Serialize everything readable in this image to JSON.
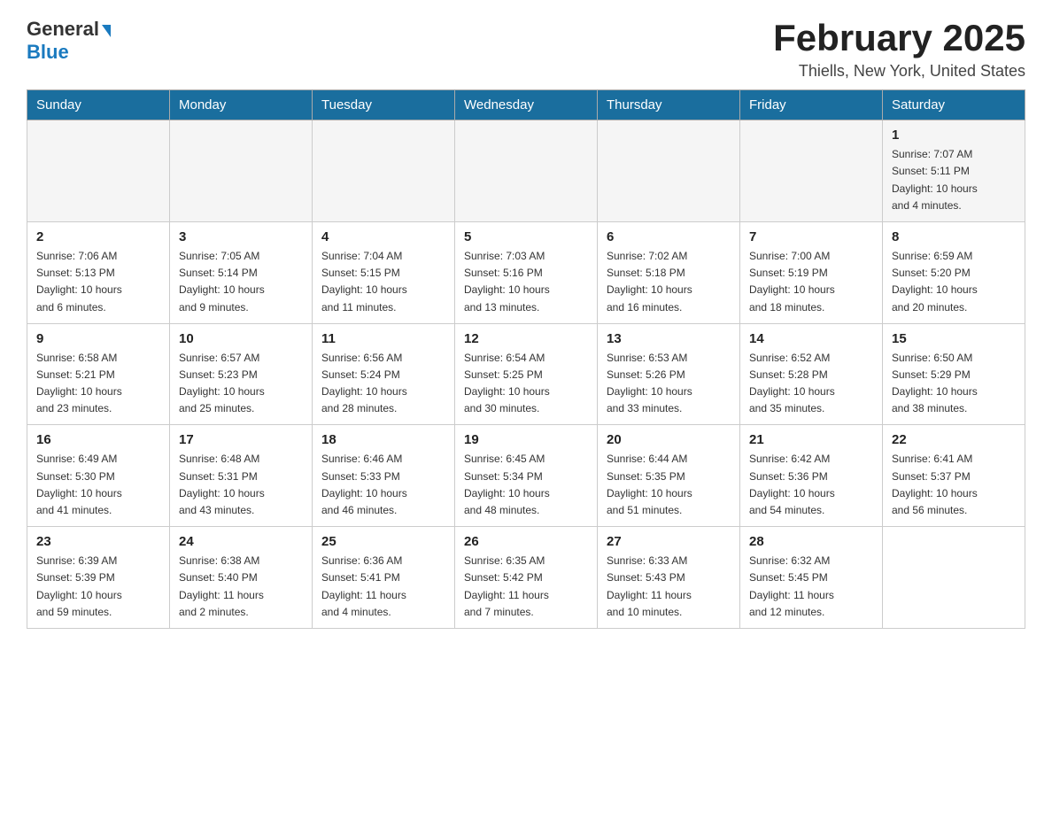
{
  "header": {
    "logo_general": "General",
    "logo_blue": "Blue",
    "title": "February 2025",
    "location": "Thiells, New York, United States"
  },
  "weekdays": [
    "Sunday",
    "Monday",
    "Tuesday",
    "Wednesday",
    "Thursday",
    "Friday",
    "Saturday"
  ],
  "weeks": [
    [
      {
        "day": "",
        "info": ""
      },
      {
        "day": "",
        "info": ""
      },
      {
        "day": "",
        "info": ""
      },
      {
        "day": "",
        "info": ""
      },
      {
        "day": "",
        "info": ""
      },
      {
        "day": "",
        "info": ""
      },
      {
        "day": "1",
        "info": "Sunrise: 7:07 AM\nSunset: 5:11 PM\nDaylight: 10 hours\nand 4 minutes."
      }
    ],
    [
      {
        "day": "2",
        "info": "Sunrise: 7:06 AM\nSunset: 5:13 PM\nDaylight: 10 hours\nand 6 minutes."
      },
      {
        "day": "3",
        "info": "Sunrise: 7:05 AM\nSunset: 5:14 PM\nDaylight: 10 hours\nand 9 minutes."
      },
      {
        "day": "4",
        "info": "Sunrise: 7:04 AM\nSunset: 5:15 PM\nDaylight: 10 hours\nand 11 minutes."
      },
      {
        "day": "5",
        "info": "Sunrise: 7:03 AM\nSunset: 5:16 PM\nDaylight: 10 hours\nand 13 minutes."
      },
      {
        "day": "6",
        "info": "Sunrise: 7:02 AM\nSunset: 5:18 PM\nDaylight: 10 hours\nand 16 minutes."
      },
      {
        "day": "7",
        "info": "Sunrise: 7:00 AM\nSunset: 5:19 PM\nDaylight: 10 hours\nand 18 minutes."
      },
      {
        "day": "8",
        "info": "Sunrise: 6:59 AM\nSunset: 5:20 PM\nDaylight: 10 hours\nand 20 minutes."
      }
    ],
    [
      {
        "day": "9",
        "info": "Sunrise: 6:58 AM\nSunset: 5:21 PM\nDaylight: 10 hours\nand 23 minutes."
      },
      {
        "day": "10",
        "info": "Sunrise: 6:57 AM\nSunset: 5:23 PM\nDaylight: 10 hours\nand 25 minutes."
      },
      {
        "day": "11",
        "info": "Sunrise: 6:56 AM\nSunset: 5:24 PM\nDaylight: 10 hours\nand 28 minutes."
      },
      {
        "day": "12",
        "info": "Sunrise: 6:54 AM\nSunset: 5:25 PM\nDaylight: 10 hours\nand 30 minutes."
      },
      {
        "day": "13",
        "info": "Sunrise: 6:53 AM\nSunset: 5:26 PM\nDaylight: 10 hours\nand 33 minutes."
      },
      {
        "day": "14",
        "info": "Sunrise: 6:52 AM\nSunset: 5:28 PM\nDaylight: 10 hours\nand 35 minutes."
      },
      {
        "day": "15",
        "info": "Sunrise: 6:50 AM\nSunset: 5:29 PM\nDaylight: 10 hours\nand 38 minutes."
      }
    ],
    [
      {
        "day": "16",
        "info": "Sunrise: 6:49 AM\nSunset: 5:30 PM\nDaylight: 10 hours\nand 41 minutes."
      },
      {
        "day": "17",
        "info": "Sunrise: 6:48 AM\nSunset: 5:31 PM\nDaylight: 10 hours\nand 43 minutes."
      },
      {
        "day": "18",
        "info": "Sunrise: 6:46 AM\nSunset: 5:33 PM\nDaylight: 10 hours\nand 46 minutes."
      },
      {
        "day": "19",
        "info": "Sunrise: 6:45 AM\nSunset: 5:34 PM\nDaylight: 10 hours\nand 48 minutes."
      },
      {
        "day": "20",
        "info": "Sunrise: 6:44 AM\nSunset: 5:35 PM\nDaylight: 10 hours\nand 51 minutes."
      },
      {
        "day": "21",
        "info": "Sunrise: 6:42 AM\nSunset: 5:36 PM\nDaylight: 10 hours\nand 54 minutes."
      },
      {
        "day": "22",
        "info": "Sunrise: 6:41 AM\nSunset: 5:37 PM\nDaylight: 10 hours\nand 56 minutes."
      }
    ],
    [
      {
        "day": "23",
        "info": "Sunrise: 6:39 AM\nSunset: 5:39 PM\nDaylight: 10 hours\nand 59 minutes."
      },
      {
        "day": "24",
        "info": "Sunrise: 6:38 AM\nSunset: 5:40 PM\nDaylight: 11 hours\nand 2 minutes."
      },
      {
        "day": "25",
        "info": "Sunrise: 6:36 AM\nSunset: 5:41 PM\nDaylight: 11 hours\nand 4 minutes."
      },
      {
        "day": "26",
        "info": "Sunrise: 6:35 AM\nSunset: 5:42 PM\nDaylight: 11 hours\nand 7 minutes."
      },
      {
        "day": "27",
        "info": "Sunrise: 6:33 AM\nSunset: 5:43 PM\nDaylight: 11 hours\nand 10 minutes."
      },
      {
        "day": "28",
        "info": "Sunrise: 6:32 AM\nSunset: 5:45 PM\nDaylight: 11 hours\nand 12 minutes."
      },
      {
        "day": "",
        "info": ""
      }
    ]
  ]
}
